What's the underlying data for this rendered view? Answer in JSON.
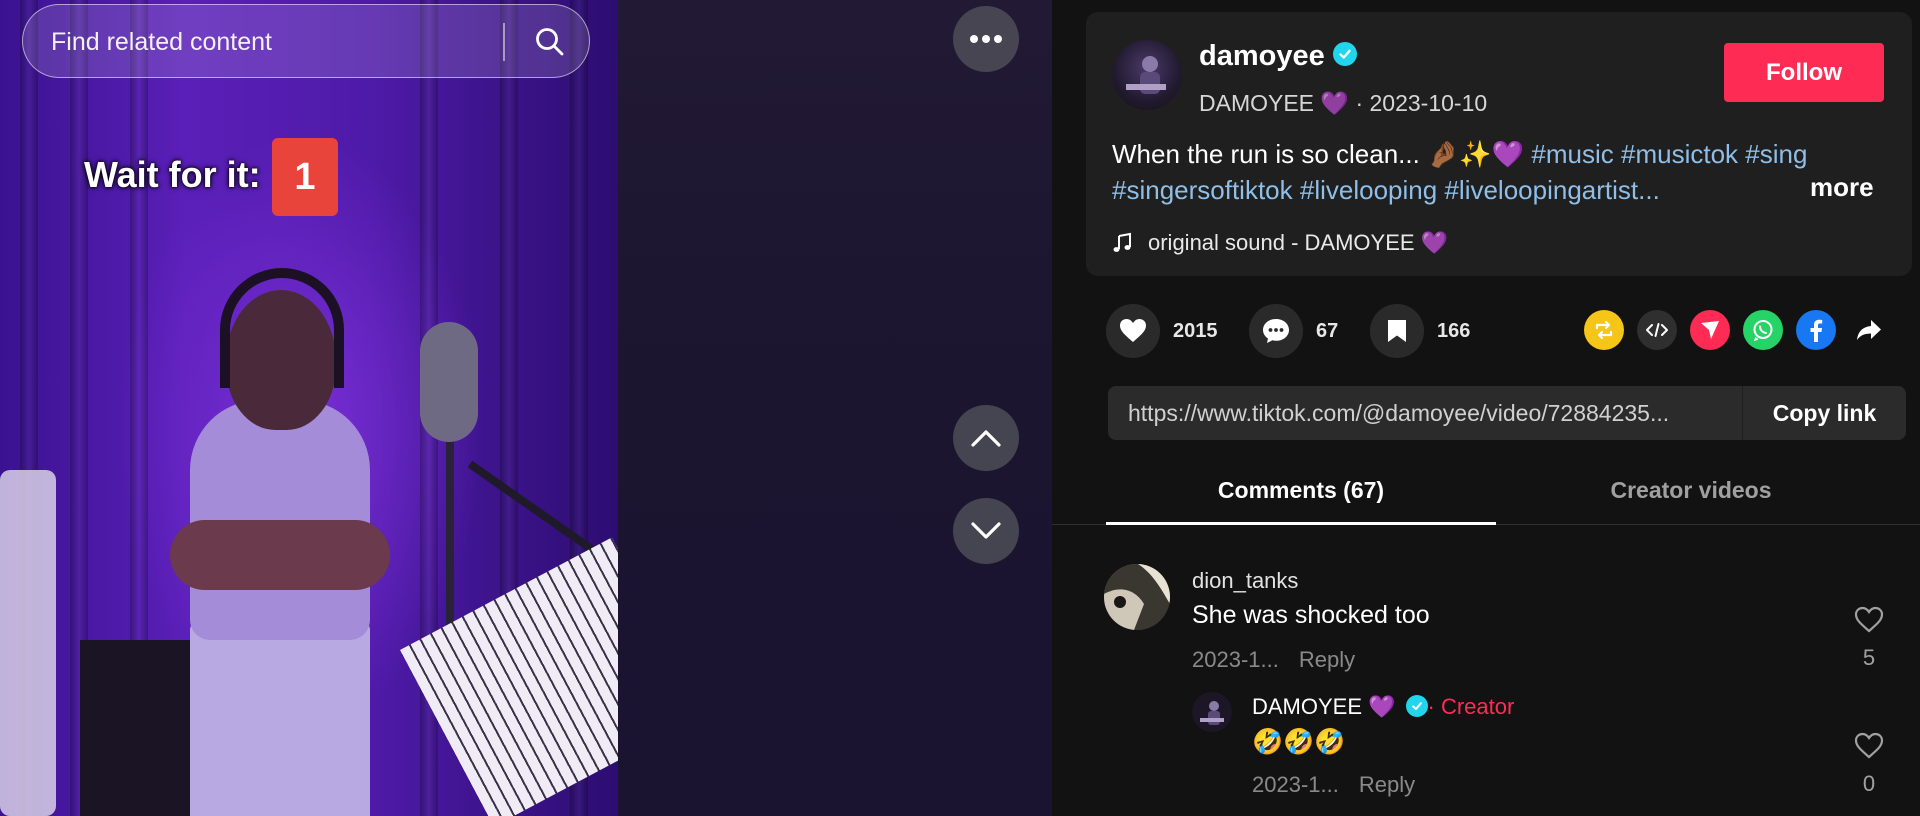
{
  "search": {
    "placeholder": "Find related content"
  },
  "video": {
    "overlay_text": "Wait for it:",
    "overlay_badge": "1"
  },
  "post": {
    "username": "damoyee",
    "display_name": "DAMOYEE 💜",
    "date": "2023-10-10",
    "follow_label": "Follow",
    "caption_text": "When the run is so clean... 🤌🏾✨💜 ",
    "hashtags": [
      "#music",
      "#musictok",
      "#sing",
      "#singersoftiktok",
      "#livelooping",
      "#liveloopingartist..."
    ],
    "more_label": "more",
    "sound": "original sound - DAMOYEE 💜"
  },
  "stats": {
    "likes": "2015",
    "comments": "67",
    "bookmarks": "166"
  },
  "share_icons": [
    "repost-icon",
    "embed-icon",
    "send-icon",
    "whatsapp-icon",
    "facebook-icon",
    "share-arrow-icon"
  ],
  "link": {
    "url": "https://www.tiktok.com/@damoyee/video/72884235...",
    "copy_label": "Copy link"
  },
  "tabs": {
    "comments": "Comments (67)",
    "creator_videos": "Creator videos"
  },
  "comments": [
    {
      "user": "dion_tanks",
      "text": "She was shocked too",
      "date": "2023-1...",
      "reply_label": "Reply",
      "likes": "5"
    },
    {
      "user": "DAMOYEE 💜",
      "creator_label": "· Creator",
      "text": "🤣🤣🤣",
      "date": "2023-1...",
      "reply_label": "Reply",
      "likes": "0"
    }
  ],
  "colors": {
    "follow": "#fe2c55",
    "hashtag": "#8fbfe8",
    "verified": "#20d5ec",
    "repost": "#f5c518",
    "send": "#fe2c55",
    "whatsapp": "#25d366",
    "facebook": "#1877f2"
  }
}
